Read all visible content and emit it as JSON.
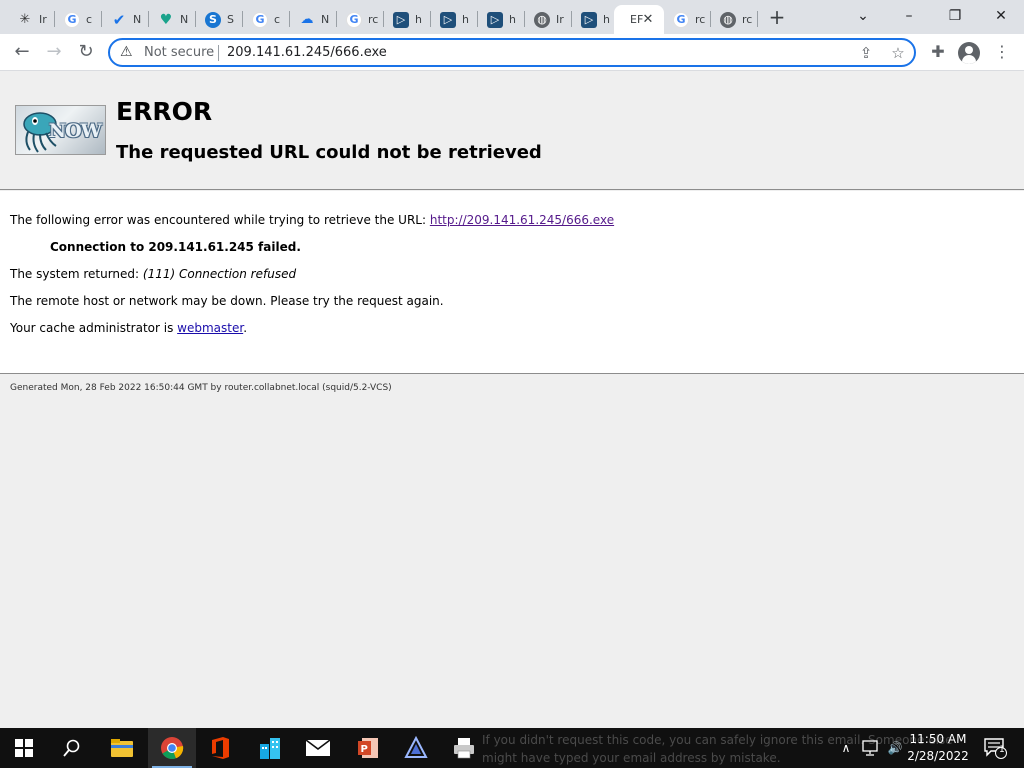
{
  "tabs": [
    {
      "title": "Ir",
      "icon": "squid-icon"
    },
    {
      "title": "c",
      "icon": "google-icon"
    },
    {
      "title": "N",
      "icon": "checkmark-app-icon"
    },
    {
      "title": "N",
      "icon": "heart-shield-icon"
    },
    {
      "title": "S",
      "icon": "s-app-icon"
    },
    {
      "title": "c",
      "icon": "google-icon"
    },
    {
      "title": "N",
      "icon": "cloud-icon"
    },
    {
      "title": "rc",
      "icon": "google-icon"
    },
    {
      "title": "h",
      "icon": "play-doc-icon"
    },
    {
      "title": "h",
      "icon": "play-doc-icon"
    },
    {
      "title": "h",
      "icon": "play-doc-icon"
    },
    {
      "title": "Ir",
      "icon": "globe-icon"
    },
    {
      "title": "h",
      "icon": "play-doc-icon"
    },
    {
      "title": "EF",
      "icon": "none",
      "active": true
    },
    {
      "title": "rc",
      "icon": "google-icon"
    },
    {
      "title": "rc",
      "icon": "globe-icon"
    }
  ],
  "toolbar": {
    "security_label": "Not secure",
    "url": "209.141.61.245/666.exe"
  },
  "page": {
    "title": "ERROR",
    "subtitle": "The requested URL could not be retrieved",
    "logo_text": "NOW",
    "line1_prefix": "The following error was encountered while trying to retrieve the URL: ",
    "line1_link": "http://209.141.61.245/666.exe",
    "line2": "Connection to 209.141.61.245 failed.",
    "line3_prefix": "The system returned: ",
    "line3_value": "(111) Connection refused",
    "line4": "The remote host or network may be down. Please try the request again.",
    "line5_prefix": "Your cache administrator is ",
    "line5_link": "webmaster",
    "line5_suffix": ".",
    "footer": "Generated Mon, 28 Feb 2022 16:50:44 GMT by router.collabnet.local (squid/5.2-VCS)"
  },
  "taskbar": {
    "ghost_line1": "If you didn't request this code, you can safely ignore this email. Someone else",
    "ghost_line2": "might have typed your email address by mistake.",
    "time": "11:50 AM",
    "date": "2/28/2022",
    "notification_count": "1"
  },
  "colors": {
    "accent": "#1a73e8",
    "link": "#1a0dab",
    "visited_link": "#551a8b",
    "page_bg": "#efefef",
    "taskbar_bg": "#101010"
  }
}
